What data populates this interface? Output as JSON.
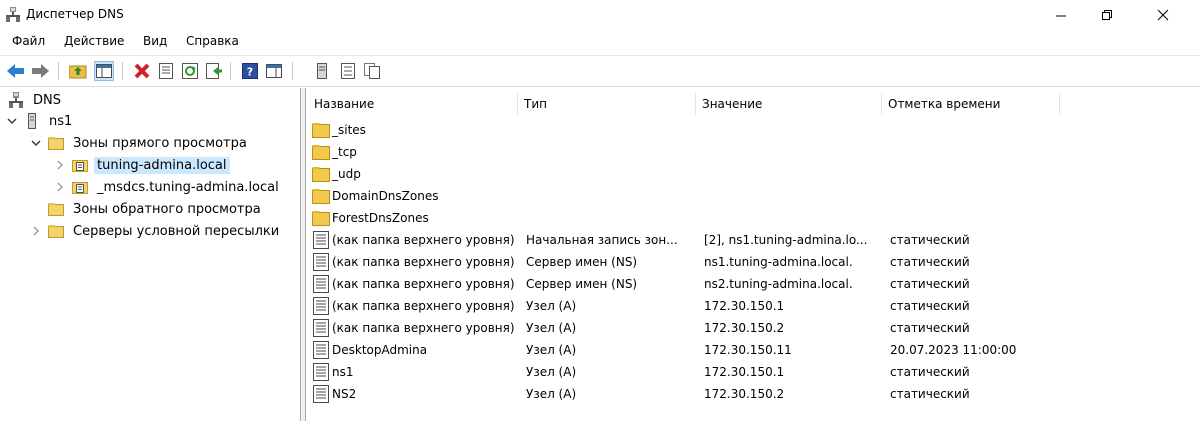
{
  "window": {
    "title": "Диспетчер DNS"
  },
  "menu": [
    "Файл",
    "Действие",
    "Вид",
    "Справка"
  ],
  "tree": [
    {
      "label": "DNS",
      "icon": "dns-icon"
    },
    {
      "label": "ns1",
      "icon": "server-icon"
    },
    {
      "label": "Зоны прямого просмотра",
      "icon": "folder-icon"
    },
    {
      "label": "tuning-admina.local",
      "icon": "zone-icon"
    },
    {
      "label": "_msdcs.tuning-admina.local",
      "icon": "zone-icon"
    },
    {
      "label": "Зоны обратного просмотра",
      "icon": "folder-icon"
    },
    {
      "label": "Серверы условной пересылки",
      "icon": "folder-icon"
    }
  ],
  "columns": [
    "Название",
    "Тип",
    "Значение",
    "Отметка времени"
  ],
  "rows": [
    {
      "name": "_sites",
      "type": "",
      "value": "",
      "time": "",
      "icon": "folder-icon"
    },
    {
      "name": "_tcp",
      "type": "",
      "value": "",
      "time": "",
      "icon": "folder-icon"
    },
    {
      "name": "_udp",
      "type": "",
      "value": "",
      "time": "",
      "icon": "folder-icon"
    },
    {
      "name": "DomainDnsZones",
      "type": "",
      "value": "",
      "time": "",
      "icon": "folder-icon"
    },
    {
      "name": "ForestDnsZones",
      "type": "",
      "value": "",
      "time": "",
      "icon": "folder-icon"
    },
    {
      "name": "(как папка верхнего уровня)",
      "type": "Начальная запись зон...",
      "value": "[2], ns1.tuning-admina.lo...",
      "time": "статический",
      "icon": "record-icon"
    },
    {
      "name": "(как папка верхнего уровня)",
      "type": "Сервер имен (NS)",
      "value": "ns1.tuning-admina.local.",
      "time": "статический",
      "icon": "record-icon"
    },
    {
      "name": "(как папка верхнего уровня)",
      "type": "Сервер имен (NS)",
      "value": "ns2.tuning-admina.local.",
      "time": "статический",
      "icon": "record-icon"
    },
    {
      "name": "(как папка верхнего уровня)",
      "type": "Узел (A)",
      "value": "172.30.150.1",
      "time": "статический",
      "icon": "record-icon"
    },
    {
      "name": "(как папка верхнего уровня)",
      "type": "Узел (A)",
      "value": "172.30.150.2",
      "time": "статический",
      "icon": "record-icon"
    },
    {
      "name": "DesktopAdmina",
      "type": "Узел (A)",
      "value": "172.30.150.11",
      "time": "20.07.2023 11:00:00",
      "icon": "record-icon"
    },
    {
      "name": "ns1",
      "type": "Узел (A)",
      "value": "172.30.150.1",
      "time": "статический",
      "icon": "record-icon"
    },
    {
      "name": "NS2",
      "type": "Узел (A)",
      "value": "172.30.150.2",
      "time": "статический",
      "icon": "record-icon"
    }
  ]
}
